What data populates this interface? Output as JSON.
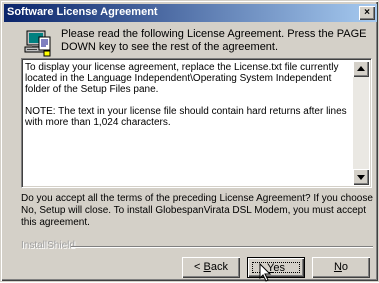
{
  "window": {
    "title": "Software License Agreement",
    "close_glyph": "×"
  },
  "header": {
    "text": "Please read the following License Agreement.  Press the PAGE DOWN key to see the rest of the agreement."
  },
  "license": {
    "paragraph1": "To display your license agreement, replace the License.txt file currently located in the Language Independent\\Operating System Independent folder of the Setup Files pane.",
    "paragraph2": "NOTE: The text in your license file should contain hard returns after lines with more than 1,024 characters."
  },
  "question": {
    "text": "Do you accept all the terms of the preceding License Agreement?  If you choose No,  Setup will close.  To install GlobespanVirata DSL Modem, you must accept this agreement."
  },
  "footer": {
    "brand": "InstallShield"
  },
  "buttons": {
    "back_prefix": "< ",
    "back_mnemonic": "B",
    "back_rest": "ack",
    "yes_mnemonic": "Y",
    "yes_rest": "es",
    "no_mnemonic": "N",
    "no_rest": "o"
  },
  "icons": {
    "header": "computer-setup-icon",
    "cursor": "mouse-pointer-icon",
    "scroll_up": "triangle-up-icon",
    "scroll_down": "triangle-down-icon"
  },
  "colors": {
    "titlebar_start": "#0a246a",
    "titlebar_end": "#a6caf0",
    "dialog_face": "#d4d0c8"
  }
}
